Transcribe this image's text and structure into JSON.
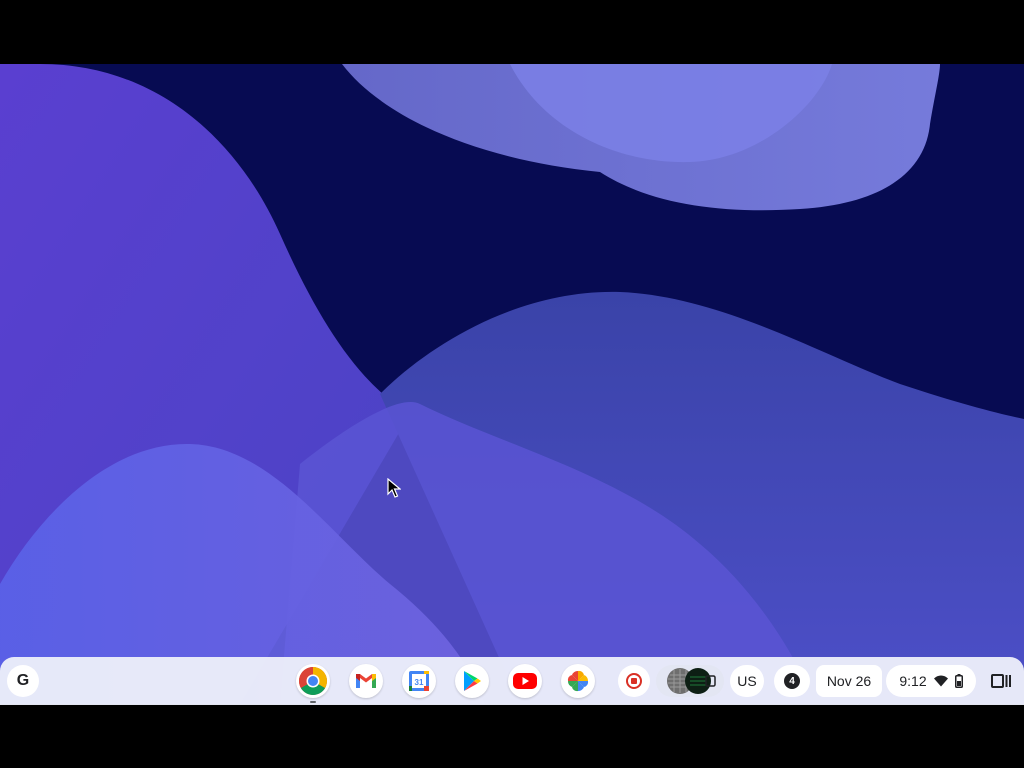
{
  "desktop": {
    "wallpaper_colors": [
      "#070b52",
      "#5a45d6",
      "#6b6fe0",
      "#3b44b2"
    ]
  },
  "shelf": {
    "launcher": {
      "icon": "google-g-icon",
      "label": "G"
    },
    "apps": [
      {
        "name": "Chrome",
        "icon": "chrome-icon"
      },
      {
        "name": "Gmail",
        "icon": "gmail-icon"
      },
      {
        "name": "Google Calendar",
        "icon": "calendar-icon",
        "label": "31"
      },
      {
        "name": "Google Play Store",
        "icon": "play-store-icon"
      },
      {
        "name": "YouTube",
        "icon": "youtube-icon"
      },
      {
        "name": "Google Photos",
        "icon": "photos-icon"
      }
    ],
    "tray": {
      "screen_record": {
        "icon": "stop-recording-icon"
      },
      "holding_space": {
        "icon": "holding-space-icon"
      },
      "ime": {
        "label": "US"
      },
      "notifications": {
        "count": "4"
      },
      "date": {
        "label": "Nov 26"
      },
      "time": {
        "label": "9:12"
      },
      "wifi": {
        "icon": "wifi-icon"
      },
      "battery": {
        "icon": "battery-icon"
      },
      "overview": {
        "icon": "overview-icon"
      }
    }
  }
}
